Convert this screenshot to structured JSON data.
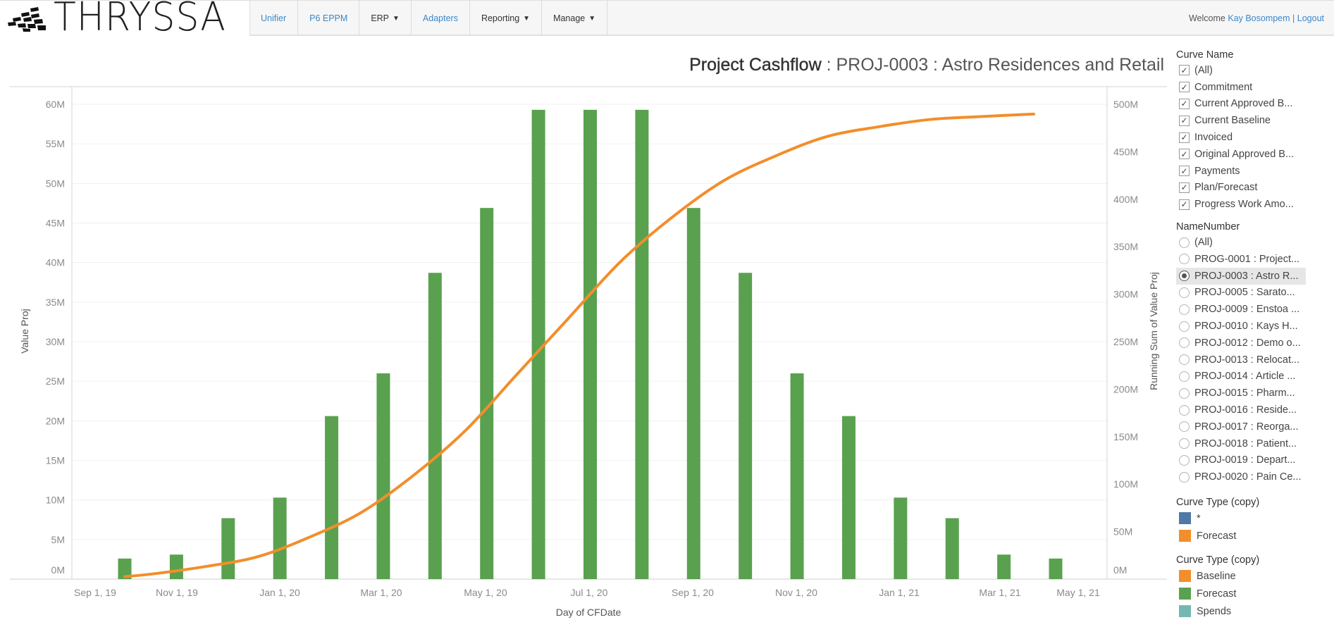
{
  "header": {
    "logo_text": "THRYSSA",
    "nav": [
      {
        "label": "Unifier",
        "type": "link"
      },
      {
        "label": "P6 EPPM",
        "type": "link"
      },
      {
        "label": "ERP",
        "type": "menu"
      },
      {
        "label": "Adapters",
        "type": "link"
      },
      {
        "label": "Reporting",
        "type": "menu"
      },
      {
        "label": "Manage",
        "type": "menu"
      }
    ],
    "caret": "▼",
    "welcome_prefix": "Welcome",
    "user_name": "Kay Bosompem",
    "separator": "|",
    "logout_label": "Logout"
  },
  "page": {
    "title_bold": "Project Cashflow",
    "title_rest": " : PROJ-0003 : Astro Residences and Retail"
  },
  "filters": {
    "curve_name": {
      "title": "Curve Name",
      "check_glyph": "✓",
      "items": [
        {
          "label": "(All)",
          "checked": true
        },
        {
          "label": "Commitment",
          "checked": true
        },
        {
          "label": "Current Approved B...",
          "checked": true
        },
        {
          "label": "Current Baseline",
          "checked": true
        },
        {
          "label": "Invoiced",
          "checked": true
        },
        {
          "label": "Original Approved B...",
          "checked": true
        },
        {
          "label": "Payments",
          "checked": true
        },
        {
          "label": "Plan/Forecast",
          "checked": true
        },
        {
          "label": "Progress Work Amo...",
          "checked": true
        }
      ]
    },
    "name_number": {
      "title": "NameNumber",
      "selected": "PROJ-0003 : Astro R...",
      "items": [
        {
          "label": "(All)"
        },
        {
          "label": "PROG-0001 : Project..."
        },
        {
          "label": "PROJ-0003 : Astro R..."
        },
        {
          "label": "PROJ-0005 : Sarato..."
        },
        {
          "label": "PROJ-0009 : Enstoa ..."
        },
        {
          "label": "PROJ-0010 : Kays H..."
        },
        {
          "label": "PROJ-0012 : Demo o..."
        },
        {
          "label": "PROJ-0013 : Relocat..."
        },
        {
          "label": "PROJ-0014 : Article ..."
        },
        {
          "label": "PROJ-0015 : Pharm..."
        },
        {
          "label": "PROJ-0016 : Reside..."
        },
        {
          "label": "PROJ-0017 : Reorga..."
        },
        {
          "label": "PROJ-0018 : Patient..."
        },
        {
          "label": "PROJ-0019 : Depart..."
        },
        {
          "label": "PROJ-0020 : Pain Ce..."
        }
      ]
    }
  },
  "legends": [
    {
      "title": "Curve Type (copy)",
      "items": [
        {
          "label": "*",
          "color": "#4e79a7"
        },
        {
          "label": "Forecast",
          "color": "#f28e2b"
        }
      ]
    },
    {
      "title": "Curve Type (copy)",
      "items": [
        {
          "label": "Baseline",
          "color": "#f28e2b"
        },
        {
          "label": "Forecast",
          "color": "#59a14f"
        },
        {
          "label": "Spends",
          "color": "#76b7b2"
        }
      ]
    }
  ],
  "chart_data": {
    "type": "bar",
    "title": "Project Cashflow : PROJ-0003 : Astro Residences and Retail",
    "xlabel": "Day of CFDate",
    "ylabel": "Value Proj",
    "y2label": "Running Sum of Value Proj",
    "x_tick_labels": [
      "Sep 1, 19",
      "Nov 1, 19",
      "Jan 1, 20",
      "Mar 1, 20",
      "May 1, 20",
      "Jul 1, 20",
      "Sep 1, 20",
      "Nov 1, 20",
      "Jan 1, 21",
      "Mar 1, 21",
      "May 1, 21"
    ],
    "y_ticks": [
      "0M",
      "5M",
      "10M",
      "15M",
      "20M",
      "25M",
      "30M",
      "35M",
      "40M",
      "45M",
      "50M",
      "55M",
      "60M"
    ],
    "y2_ticks": [
      "0M",
      "50M",
      "100M",
      "150M",
      "200M",
      "250M",
      "300M",
      "350M",
      "400M",
      "450M",
      "500M"
    ],
    "ylim": [
      0,
      60
    ],
    "y2lim": [
      0,
      500
    ],
    "units": "millions",
    "grid": true,
    "categories": [
      "Sep 2019",
      "Oct 2019",
      "Nov 2019",
      "Dec 2019",
      "Jan 2020",
      "Feb 2020",
      "Mar 2020",
      "Apr 2020",
      "May 2020",
      "Jun 2020",
      "Jul 2020",
      "Aug 2020",
      "Sep 2020",
      "Oct 2020",
      "Nov 2020",
      "Dec 2020",
      "Jan 2021",
      "Feb 2021",
      "Mar 2021"
    ],
    "series": [
      {
        "name": "Forecast (Value Proj)",
        "type": "bar",
        "axis": "left",
        "color": "#59a14f",
        "values": [
          2.6,
          3.1,
          7.7,
          10.3,
          20.6,
          26.0,
          38.7,
          46.9,
          59.3,
          59.3,
          59.3,
          46.9,
          38.7,
          26.0,
          20.6,
          10.3,
          7.7,
          3.1,
          2.6
        ]
      },
      {
        "name": "Running Sum of Value Proj",
        "type": "line",
        "axis": "right",
        "color": "#f28e2b",
        "values": [
          2.6,
          5.7,
          13.4,
          23.7,
          44.3,
          70.3,
          109.0,
          155.9,
          215.2,
          274.5,
          333.8,
          380.7,
          419.4,
          445.4,
          466.0,
          476.3,
          484.0,
          487.1,
          489.7
        ]
      }
    ]
  }
}
